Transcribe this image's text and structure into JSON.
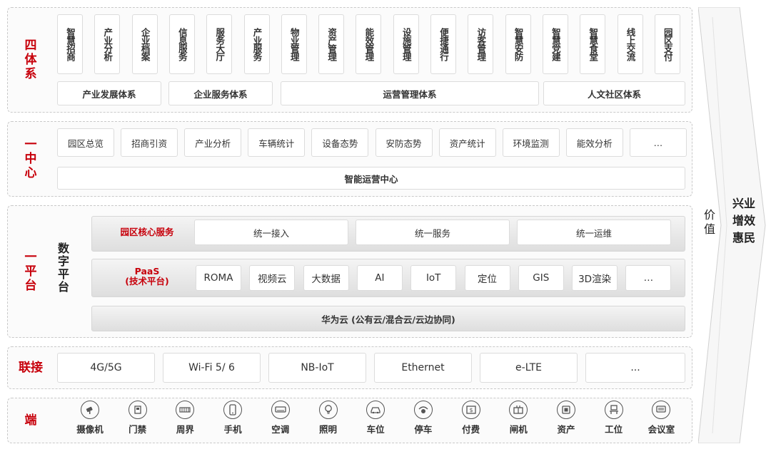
{
  "systems": {
    "layer_label": "四体系",
    "items": [
      "智慧招商",
      "产业分析",
      "企业档案",
      "信息服务",
      "服务大厅",
      "产业服务",
      "物业管理",
      "资产管理",
      "能效管理",
      "设施管理",
      "便捷通行",
      "访客管理",
      "智慧安防",
      "智慧党建",
      "智慧食堂",
      "线上交流",
      "园区支付"
    ],
    "groups": [
      "产业发展体系",
      "企业服务体系",
      "运营管理体系",
      "人文社区体系"
    ]
  },
  "center": {
    "layer_label": "一中心",
    "items": [
      "园区总览",
      "招商引资",
      "产业分析",
      "车辆统计",
      "设备态势",
      "安防态势",
      "资产统计",
      "环境监测",
      "能效分析",
      "…"
    ],
    "main": "智能运营中心"
  },
  "platform": {
    "layer_label": "一平台",
    "digital_label": "数字平台",
    "core_label": "园区核心服务",
    "core_items": [
      "统一接入",
      "统一服务",
      "统一运维"
    ],
    "paas_label": "PaaS\n(技术平台)",
    "paas_items": [
      "ROMA",
      "视频云",
      "大数据",
      "AI",
      "IoT",
      "定位",
      "GIS",
      "3D渲染",
      "…"
    ],
    "cloud": "华为云 (公有云/混合云/云边协同)"
  },
  "connect": {
    "layer_label": "联接",
    "items": [
      "4G/5G",
      "Wi-Fi 5/ 6",
      "NB-IoT",
      "Ethernet",
      "e-LTE",
      "..."
    ]
  },
  "terminal": {
    "layer_label": "端",
    "items": [
      {
        "label": "摄像机",
        "icon": "camera-icon"
      },
      {
        "label": "门禁",
        "icon": "door-access-icon"
      },
      {
        "label": "周界",
        "icon": "perimeter-icon"
      },
      {
        "label": "手机",
        "icon": "phone-icon"
      },
      {
        "label": "空调",
        "icon": "air-conditioner-icon"
      },
      {
        "label": "照明",
        "icon": "light-bulb-icon"
      },
      {
        "label": "车位",
        "icon": "car-icon"
      },
      {
        "label": "停车",
        "icon": "parking-icon"
      },
      {
        "label": "付费",
        "icon": "payment-icon"
      },
      {
        "label": "闸机",
        "icon": "gate-icon"
      },
      {
        "label": "资产",
        "icon": "asset-icon"
      },
      {
        "label": "工位",
        "icon": "workstation-icon"
      },
      {
        "label": "会议室",
        "icon": "meeting-room-icon"
      }
    ]
  },
  "value": {
    "label": "价值",
    "main": "兴业增效惠民"
  },
  "colors": {
    "accent": "#c7000b",
    "border": "#c9c9c9",
    "box_border": "#dcdcdc"
  }
}
